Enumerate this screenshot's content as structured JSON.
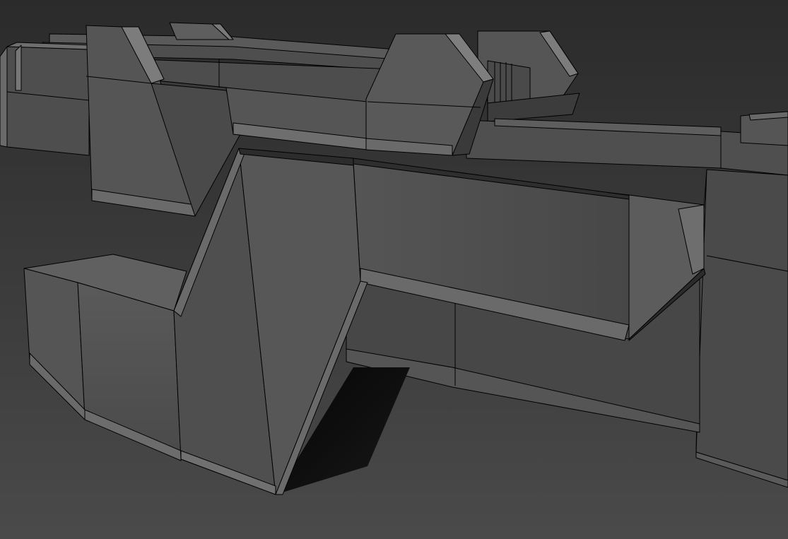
{
  "viewport": {
    "background_top": "#2b2b2b",
    "background_bottom": "#4a4a4a",
    "shade_light": "#7a7a7a",
    "shade_mid": "#5c5c5c",
    "shade_dark": "#3c3c3c",
    "shade_shadow": "#0c0c0c",
    "wire_color": "#000000"
  }
}
